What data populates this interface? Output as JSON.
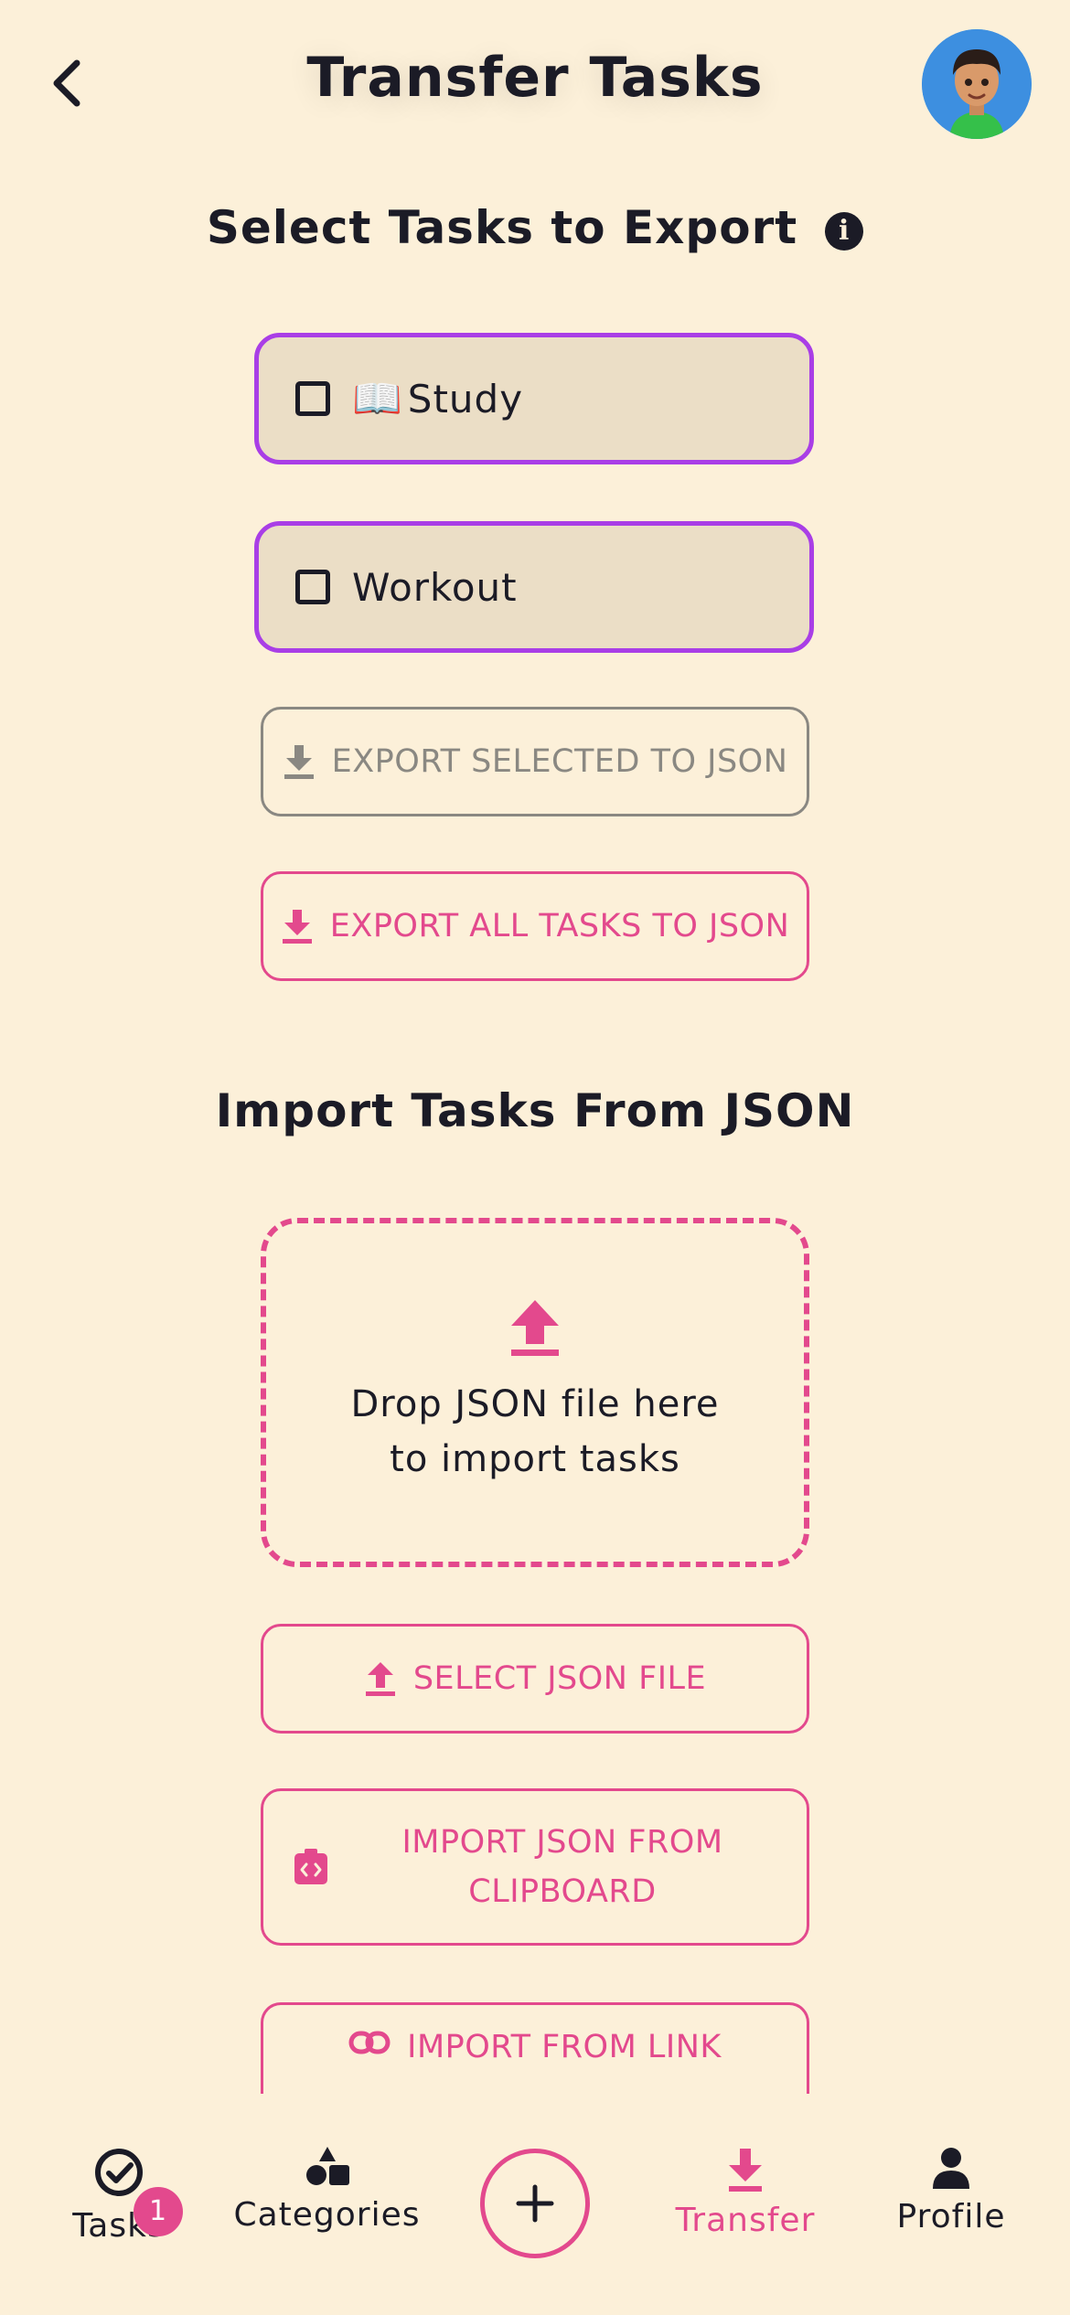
{
  "header": {
    "title": "Transfer Tasks"
  },
  "export_section": {
    "title": "Select Tasks to Export",
    "tasks": [
      {
        "emoji": "📖",
        "label": "Study",
        "checked": false
      },
      {
        "emoji": "",
        "label": "Workout",
        "checked": false
      }
    ],
    "export_selected_label": "EXPORT SELECTED TO JSON",
    "export_all_label": "EXPORT ALL TASKS TO JSON"
  },
  "import_section": {
    "title": "Import Tasks From JSON",
    "drop_line1": "Drop JSON file here",
    "drop_line2": "to import tasks",
    "select_file_label": "SELECT JSON FILE",
    "clipboard_line1": "IMPORT JSON FROM",
    "clipboard_line2": "CLIPBOARD",
    "link_label": "IMPORT FROM LINK"
  },
  "bottom_nav": {
    "tasks": "Tasks",
    "tasks_badge": "1",
    "categories": "Categories",
    "transfer": "Transfer",
    "profile": "Profile",
    "active": "transfer"
  },
  "colors": {
    "background": "#fcf0d9",
    "accent": "#e3498d",
    "card_border": "#a93ee6",
    "card_fill": "#ebdec6",
    "disabled": "#8a8882",
    "text": "#1b1b26"
  }
}
